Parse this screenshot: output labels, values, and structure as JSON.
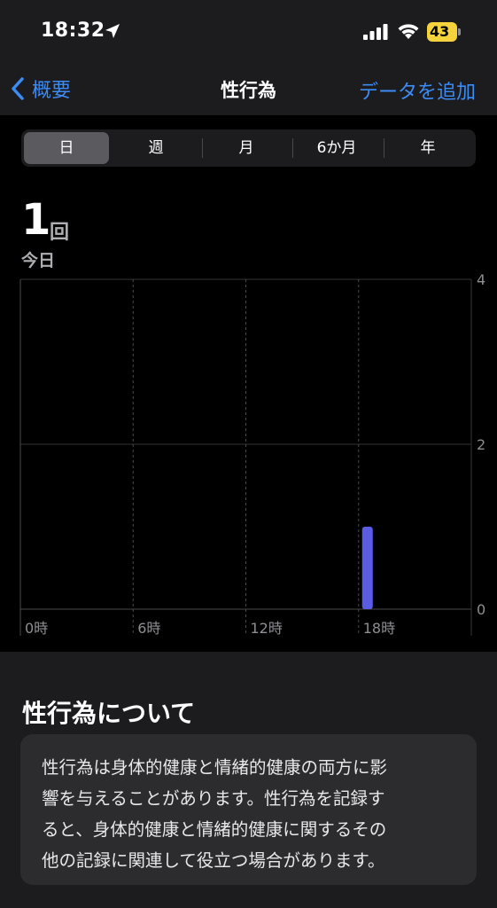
{
  "status_bar": {
    "time": "18:32",
    "battery_level": "43"
  },
  "nav": {
    "back_label": "概要",
    "title": "性行為",
    "add_label": "データを追加"
  },
  "segments": [
    {
      "label": "日",
      "selected": true
    },
    {
      "label": "週",
      "selected": false
    },
    {
      "label": "月",
      "selected": false
    },
    {
      "label": "6か月",
      "selected": false
    },
    {
      "label": "年",
      "selected": false
    }
  ],
  "summary": {
    "value": "1",
    "unit": "回",
    "period": "今日"
  },
  "chart_data": {
    "type": "bar",
    "x_tick_labels": [
      "0時",
      "6時",
      "12時",
      "18時"
    ],
    "y_tick_labels": [
      "4",
      "2",
      "0"
    ],
    "ylim": [
      0,
      4
    ],
    "xlim_hours": [
      0,
      24
    ],
    "bars": [
      {
        "hour": 18,
        "value": 1
      }
    ],
    "bar_color": "#5a5ce6",
    "grid": true
  },
  "about": {
    "title": "性行為について",
    "lines": [
      "性行為は身体的健康と情緒的健康の両方に影",
      "響を与えることがあります。性行為を記録す",
      "ると、身体的健康と情緒的健康に関するその",
      "他の記録に関連して役立つ場合があります。"
    ]
  },
  "colors": {
    "accent": "#3d8cf5",
    "battery": "#f5d33c"
  }
}
